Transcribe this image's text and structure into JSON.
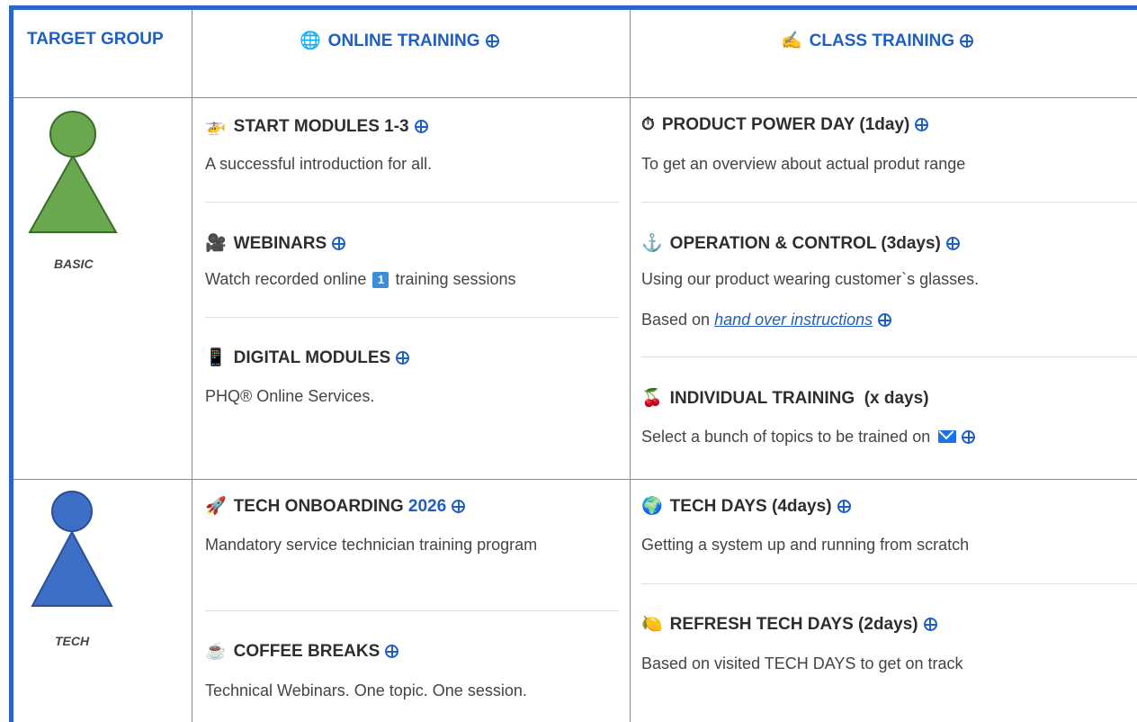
{
  "header": {
    "target_group": "TARGET GROUP",
    "online_training": "ONLINE TRAINING",
    "online_icon": "globe-icon",
    "class_training": "CLASS TRAINING",
    "class_icon": "writing-hand-icon"
  },
  "groups": {
    "basic_label": "BASIC",
    "tech_label": "TECH"
  },
  "online": {
    "start_modules": {
      "title": "START MODULES 1-3",
      "desc": "A successful introduction for all.",
      "icon": "helicopter-icon"
    },
    "webinars": {
      "title": "WEBINARS",
      "desc_before": "Watch recorded online",
      "badge": "1",
      "desc_after": "training sessions",
      "icon": "movie-camera-icon"
    },
    "digital_modules": {
      "title": "DIGITAL MODULES",
      "desc": "PHQ® Online Services.",
      "icon": "mobile-phone-icon"
    },
    "tech_onboarding": {
      "title": "TECH ONBOARDING",
      "year": "2026",
      "desc": "Mandatory service technician training program",
      "icon": "rocket-icon"
    },
    "coffee_breaks": {
      "title": "COFFEE BREAKS",
      "desc": "Technical Webinars. One topic. One session.",
      "icon": "coffee-icon"
    }
  },
  "class": {
    "product_power_day": {
      "title": "PRODUCT POWER DAY (1day)",
      "desc": "To get an overview about actual produt range",
      "icon": "stopwatch-icon"
    },
    "operation_control": {
      "title": "OPERATION & CONTROL (3days)",
      "desc": "Using our product wearing customer`s glasses.",
      "desc2_prefix": "Based on",
      "link": "hand over instructions",
      "icon": "anchor-icon"
    },
    "individual_training": {
      "title": "INDIVIDUAL TRAINING  (x days)",
      "desc": "Select a bunch of topics to be trained on",
      "icon": "cherries-icon"
    },
    "tech_days": {
      "title": "TECH DAYS (4days)",
      "desc": "Getting a system up and running from scratch",
      "icon": "globe-icon"
    },
    "refresh_tech_days": {
      "title": "REFRESH TECH DAYS (2days)",
      "desc": "Based on visited TECH DAYS to get on track",
      "icon": "lemon-icon"
    }
  },
  "colors": {
    "accent": "#1f5fbf",
    "frame": "#2a66c8",
    "basic_figure": "#6aa84f",
    "tech_figure": "#3d6fc6"
  }
}
